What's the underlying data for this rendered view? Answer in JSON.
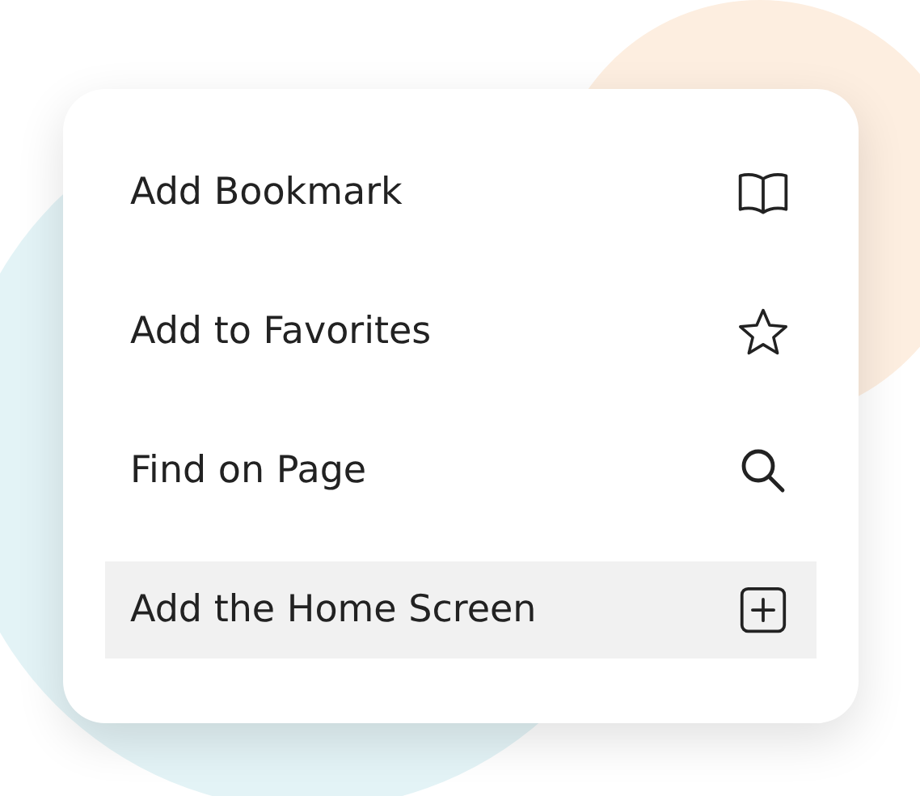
{
  "menu": {
    "items": [
      {
        "label": "Add Bookmark",
        "selected": false
      },
      {
        "label": "Add to Favorites",
        "selected": false
      },
      {
        "label": "Find on Page",
        "selected": false
      },
      {
        "label": "Add the Home Screen",
        "selected": true
      }
    ]
  }
}
